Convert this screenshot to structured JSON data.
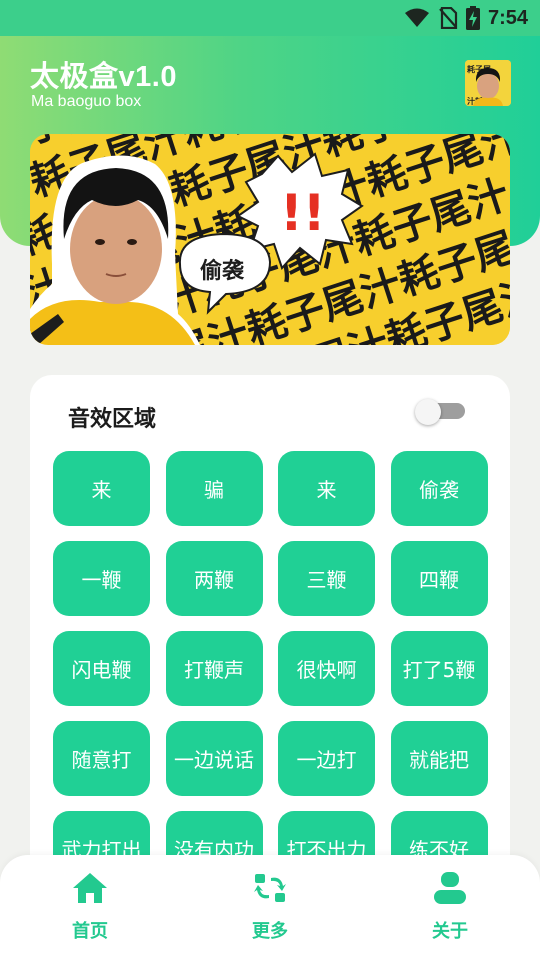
{
  "status_bar": {
    "time": "7:54"
  },
  "header": {
    "title": "太极盒v1.0",
    "subtitle": "Ma baoguo box"
  },
  "banner": {
    "pattern_text": "耗子尾汁",
    "exclaim": "!!",
    "bubble_text": "偷袭"
  },
  "sound_area": {
    "title": "音效区域",
    "toggle_on": false,
    "buttons": [
      "来",
      "骗",
      "来",
      "偷袭",
      "一鞭",
      "两鞭",
      "三鞭",
      "四鞭",
      "闪电鞭",
      "打鞭声",
      "很快啊",
      "打了5鞭",
      "随意打",
      "一边说话",
      "一边打",
      "就能把",
      "武力打出",
      "没有内功",
      "打不出力",
      "练不好"
    ]
  },
  "bottom_nav": {
    "items": [
      {
        "label": "首页",
        "icon": "home-icon"
      },
      {
        "label": "更多",
        "icon": "refresh-icon"
      },
      {
        "label": "关于",
        "icon": "person-icon"
      }
    ]
  },
  "colors": {
    "accent": "#20d095",
    "header_start": "#8fdc74",
    "header_end": "#20cf98",
    "nav_active": "#23c98f"
  }
}
